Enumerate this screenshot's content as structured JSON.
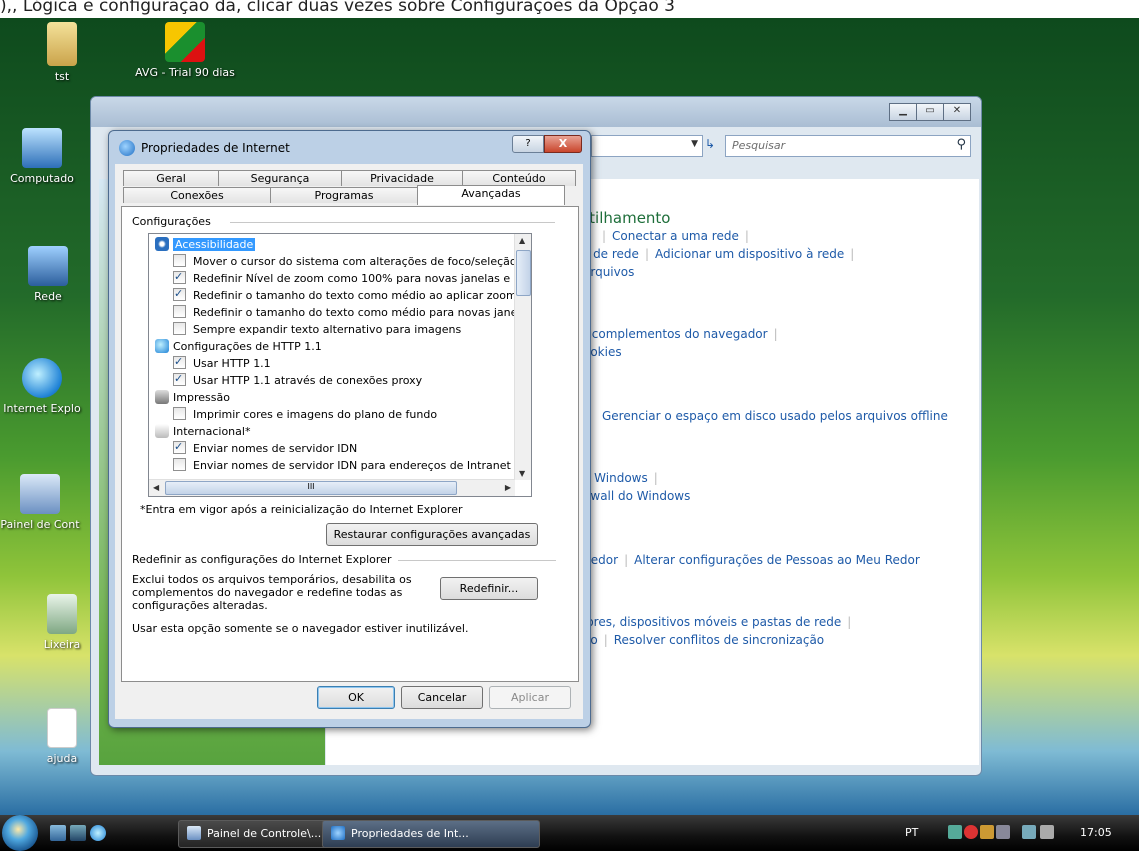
{
  "top_caption": "),, Lógica e configuração da, clicar duas vezes sobre Configurações da Opção 3",
  "desktop_icons": [
    {
      "label": "tst",
      "name": "folder-icon"
    },
    {
      "label": "AVG - Trial 90 dias",
      "name": "avg-shortcut-icon"
    },
    {
      "label": "Computado",
      "name": "computer-icon"
    },
    {
      "label": "Rede",
      "name": "network-icon"
    },
    {
      "label": "Internet Explo",
      "name": "ie-icon"
    },
    {
      "label": "Painel de Cont",
      "name": "control-panel-icon"
    },
    {
      "label": "Lixeira",
      "name": "recycle-bin-icon"
    },
    {
      "label": "ajuda",
      "name": "help-file-icon"
    }
  ],
  "explorer": {
    "search_placeholder": "Pesquisar",
    "links": {
      "heading_partial": "rtilhamento",
      "connect": "Conectar a uma rede",
      "net_prefix": "s de rede",
      "add_device": "Adicionar um dispositivo à rede",
      "files": "arquivos",
      "addons": "r complementos do navegador",
      "cookies": "ookies",
      "offline": "Gerenciar o espaço em disco usado pelos arquivos offline",
      "windows": "o Windows",
      "firewall": "ewall do Windows",
      "near_me": "Redor",
      "near_me_config": "Alterar configurações de Pessoas ao Meu Redor",
      "devices": "lores, dispositivos móveis e pastas de rede",
      "sync_prefix": "ão",
      "sync": "Resolver conflitos de sincronização"
    }
  },
  "dialog": {
    "title": "Propriedades de Internet",
    "help_label": "?",
    "close_label": "X",
    "tabs_row1": [
      "Geral",
      "Segurança",
      "Privacidade",
      "Conteúdo"
    ],
    "tabs_row2": [
      "Conexões",
      "Programas",
      "Avançadas"
    ],
    "active_tab": "Avançadas",
    "settings_group_label": "Configurações",
    "settings": [
      {
        "type": "category",
        "text": "Acessibilidade",
        "icon": "accessibility-icon",
        "selected": true
      },
      {
        "type": "check",
        "checked": false,
        "text": "Mover o cursor do sistema com alterações de foco/seleção"
      },
      {
        "type": "check",
        "checked": true,
        "text": "Redefinir Nível de zoom como 100% para novas janelas e"
      },
      {
        "type": "check",
        "checked": true,
        "text": "Redefinir o tamanho do texto como médio ao aplicar zoom"
      },
      {
        "type": "check",
        "checked": false,
        "text": "Redefinir o tamanho do texto como médio para novas jane"
      },
      {
        "type": "check",
        "checked": false,
        "text": "Sempre expandir texto alternativo para imagens"
      },
      {
        "type": "category",
        "text": "Configurações de HTTP 1.1",
        "icon": "ie-small-icon"
      },
      {
        "type": "check",
        "checked": true,
        "text": "Usar HTTP 1.1"
      },
      {
        "type": "check",
        "checked": true,
        "text": "Usar HTTP 1.1 através de conexões proxy"
      },
      {
        "type": "category",
        "text": "Impressão",
        "icon": "printer-icon"
      },
      {
        "type": "check",
        "checked": false,
        "text": "Imprimir cores e imagens do plano de fundo"
      },
      {
        "type": "category",
        "text": "Internacional*",
        "icon": "international-icon"
      },
      {
        "type": "check",
        "checked": true,
        "text": "Enviar nomes de servidor IDN"
      },
      {
        "type": "check",
        "checked": false,
        "text": "Enviar nomes de servidor IDN para endereços de Intranet"
      }
    ],
    "hscroll_grip": "III",
    "restart_note": "*Entra em vigor após a reinicialização do Internet Explorer",
    "restore_button": "Restaurar configurações avançadas",
    "reset_group_label": "Redefinir as configurações do Internet Explorer",
    "reset_description": "Exclui todos os arquivos temporários, desabilita os complementos do navegador e redefine todas as configurações alteradas.",
    "reset_button": "Redefinir...",
    "reset_warning": "Usar esta opção somente se o navegador estiver inutilizável.",
    "ok": "OK",
    "cancel": "Cancelar",
    "apply": "Aplicar"
  },
  "taskbar": {
    "tasks": [
      {
        "label": "Painel de Controle\\...",
        "active": false
      },
      {
        "label": "Propriedades de Int...",
        "active": true
      }
    ],
    "language": "PT",
    "clock": "17:05"
  },
  "colors": {
    "selection": "#3399ff",
    "link": "#1e5aa8",
    "dialog_frame": "#bcd0e6"
  }
}
